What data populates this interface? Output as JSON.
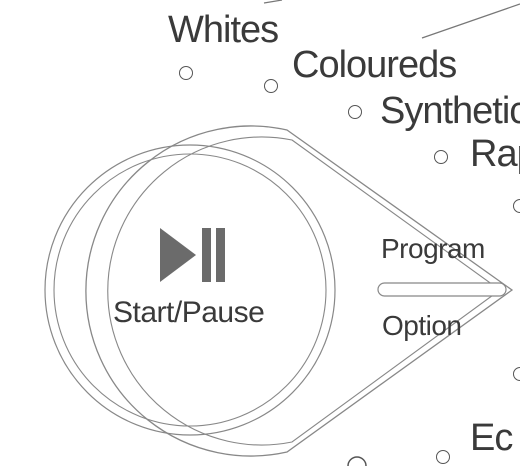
{
  "programs": {
    "whites": "Whites",
    "coloureds": "Coloureds",
    "synthetics": "Synthetic",
    "rapid": "Rap",
    "eco": "Ec"
  },
  "dial": {
    "start_pause_label": "Start/Pause",
    "program_label": "Program",
    "option_label": "Option",
    "play_pause_icon": "play-pause-icon"
  },
  "colors": {
    "ink": "#3a3a3a",
    "icon": "#6b6b6b",
    "line": "#888888",
    "background": "#ffffff"
  }
}
